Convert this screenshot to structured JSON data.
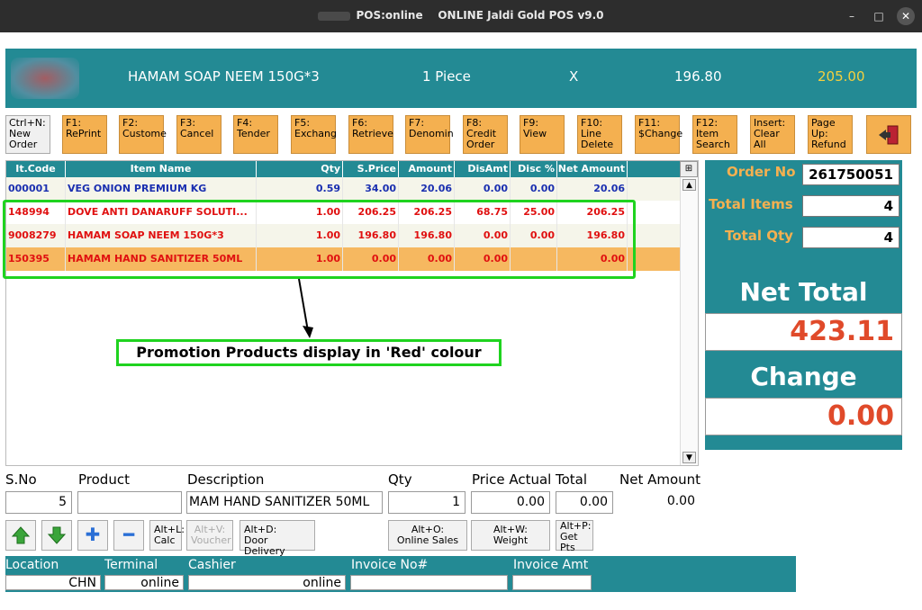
{
  "window": {
    "title_left": "POS:online",
    "title_right": "ONLINE Jaldi Gold POS v9.0",
    "minimize": "–",
    "maximize": "□",
    "close": "✕"
  },
  "header": {
    "item": "HAMAM SOAP NEEM 150G*3",
    "uom": "1 Piece",
    "times": "X",
    "price": "196.80",
    "total": "205.00"
  },
  "toolbar": [
    {
      "label": "Ctrl+N:\nNew\nOrder"
    },
    {
      "label": "F1:\nRePrint"
    },
    {
      "label": "F2:\nCustome"
    },
    {
      "label": "F3:\nCancel"
    },
    {
      "label": "F4:\nTender"
    },
    {
      "label": "F5:\nExchang"
    },
    {
      "label": "F6:\nRetrieve"
    },
    {
      "label": "F7:\nDenomin"
    },
    {
      "label": "F8:\nCredit\nOrder"
    },
    {
      "label": "F9:\nView"
    },
    {
      "label": "F10:\nLine\nDelete"
    },
    {
      "label": "F11:\n$Change"
    },
    {
      "label": "F12:\nItem\nSearch"
    },
    {
      "label": "Insert:\nClear All"
    },
    {
      "label": "Page\nUp:\nRefund"
    },
    {
      "label": "exit-icon"
    }
  ],
  "grid": {
    "columns": [
      "It.Code",
      "Item Name",
      "Qty",
      "S.Price",
      "Amount",
      "DisAmt",
      "Disc %",
      "Net Amount"
    ],
    "rows": [
      {
        "code": "000001",
        "name": "VEG ONION PREMIUM KG",
        "qty": "0.59",
        "sprice": "34.00",
        "amount": "20.06",
        "disamt": "0.00",
        "disc": "0.00",
        "net": "20.06",
        "color": "#1a2fb0",
        "bg": "#f5f5ea"
      },
      {
        "code": "148994",
        "name": "DOVE ANTI DANARUFF SOLUTI...",
        "qty": "1.00",
        "sprice": "206.25",
        "amount": "206.25",
        "disamt": "68.75",
        "disc": "25.00",
        "net": "206.25",
        "color": "#e01010",
        "bg": "#ffffff"
      },
      {
        "code": "9008279",
        "name": "HAMAM SOAP NEEM 150G*3",
        "qty": "1.00",
        "sprice": "196.80",
        "amount": "196.80",
        "disamt": "0.00",
        "disc": "0.00",
        "net": "196.80",
        "color": "#e01010",
        "bg": "#f5f5ea"
      },
      {
        "code": "150395",
        "name": "HAMAM HAND SANITIZER 50ML",
        "qty": "1.00",
        "sprice": "0.00",
        "amount": "0.00",
        "disamt": "0.00",
        "disc": "",
        "net": "0.00",
        "color": "#e01010",
        "bg": "#f6b860"
      }
    ]
  },
  "annotation": {
    "text": "Promotion Products display in 'Red' colour"
  },
  "summary": {
    "order_no_label": "Order No",
    "order_no": "261750051",
    "total_items_label": "Total Items",
    "total_items": "4",
    "total_qty_label": "Total Qty",
    "total_qty": "4",
    "net_total_label": "Net Total",
    "net_total": "423.11",
    "change_label": "Change",
    "change": "0.00"
  },
  "entry": {
    "sno_label": "S.No",
    "product_label": "Product",
    "description_label": "Description",
    "qty_label": "Qty",
    "price_actual_label": "Price Actual",
    "total_label": "Total",
    "net_amount_label": "Net Amount",
    "sno": "5",
    "product": "",
    "description": "MAM HAND SANITIZER 50ML",
    "qty": "1",
    "price_actual": "0.00",
    "total": "0.00",
    "net_amount": "0.00"
  },
  "actions": {
    "calc": "Alt+L:\nCalc",
    "voucher": "Alt+V:\nVoucher",
    "door_delivery": "Alt+D:\nDoor Delivery",
    "online_sales": "Alt+O:\nOnline Sales",
    "weight": "Alt+W:\nWeight",
    "get_pts": "Alt+P:\nGet\nPts"
  },
  "footer": {
    "location_label": "Location",
    "terminal_label": "Terminal",
    "cashier_label": "Cashier",
    "invoice_no_label": "Invoice No#",
    "invoice_amt_label": "Invoice Amt",
    "location": "CHN",
    "terminal": "online",
    "cashier": "online",
    "invoice_no": "",
    "invoice_amt": ""
  },
  "colors": {
    "teal": "#238a94",
    "orange": "#f4b050",
    "red": "#e01010",
    "blue": "#1a2fb0",
    "highlight_green": "#1fd31f"
  }
}
